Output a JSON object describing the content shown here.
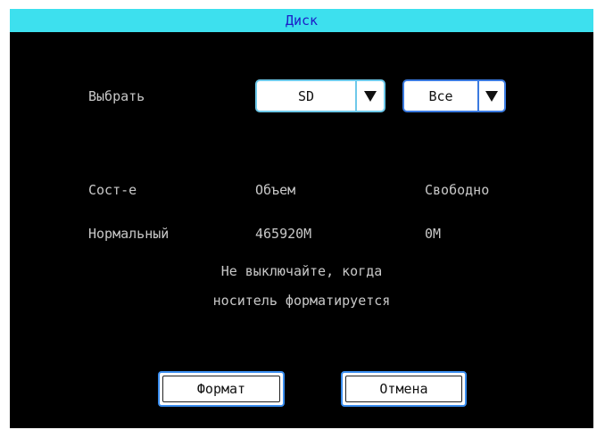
{
  "window": {
    "title": "Диск"
  },
  "select": {
    "label": "Выбрать",
    "storage": {
      "value": "SD"
    },
    "scope": {
      "value": "Все"
    }
  },
  "table": {
    "headers": [
      "Сост-е",
      "Объем",
      "Свободно"
    ],
    "row": [
      "Нормальный",
      "465920M",
      "0M"
    ]
  },
  "warning": {
    "line1": "Не выключайте, когда",
    "line2": "носитель форматируется"
  },
  "buttons": {
    "format": "Формат",
    "cancel": "Отмена"
  },
  "icons": {
    "dropdown_arrow": "triangle-down-icon"
  },
  "colors": {
    "titlebar_bg": "#3de0ee",
    "title_text": "#1d1ec8",
    "accent": "#3a8ef0",
    "text": "#c8c8c8"
  }
}
